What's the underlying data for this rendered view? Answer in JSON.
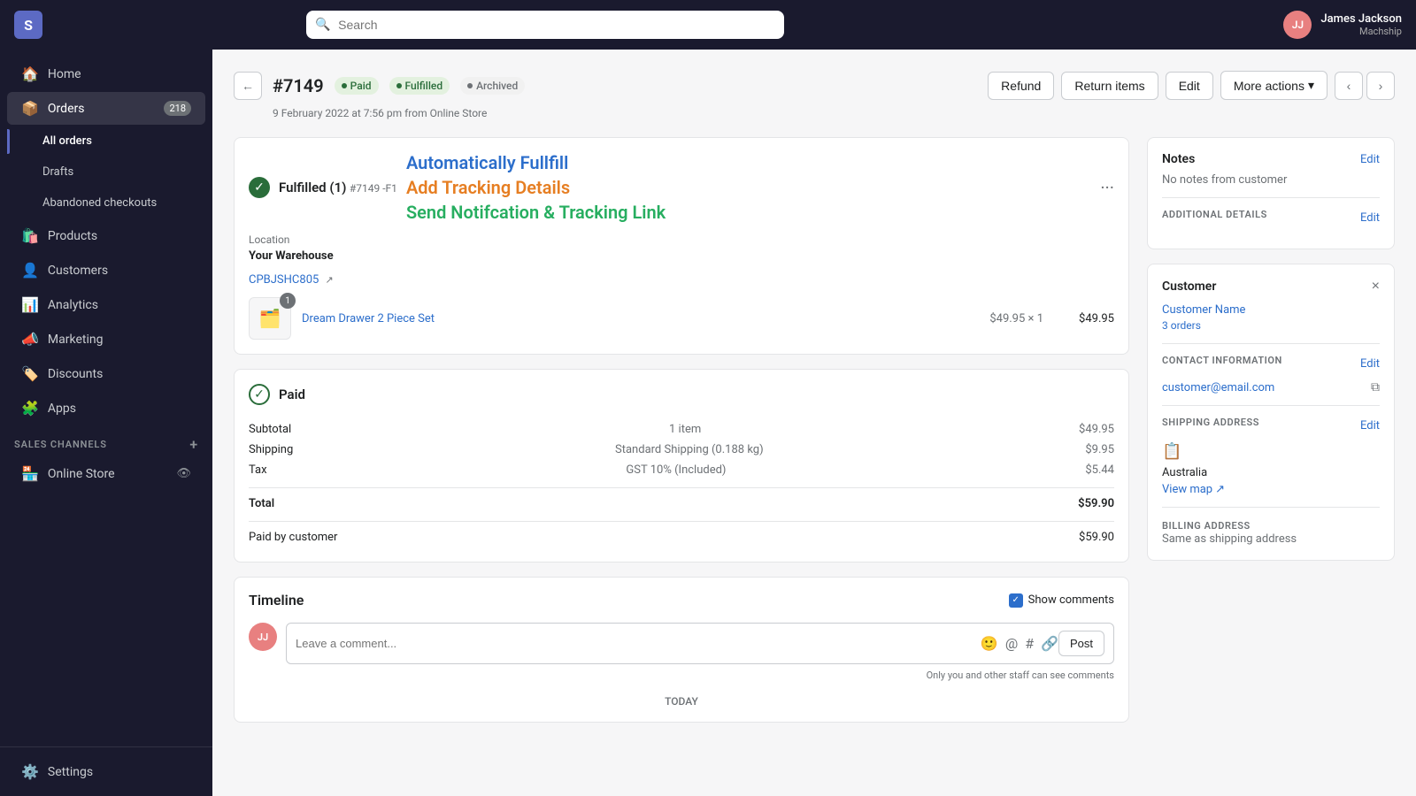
{
  "topnav": {
    "logo_text": "S",
    "search_placeholder": "Search",
    "user_initials": "JJ",
    "user_name": "James Jackson",
    "user_shop": "Machship"
  },
  "sidebar": {
    "items": [
      {
        "id": "home",
        "label": "Home",
        "icon": "🏠",
        "badge": null
      },
      {
        "id": "orders",
        "label": "Orders",
        "icon": "📦",
        "badge": "218"
      },
      {
        "id": "all-orders",
        "label": "All orders",
        "icon": null,
        "badge": null,
        "sub": true,
        "active": true
      },
      {
        "id": "drafts",
        "label": "Drafts",
        "icon": null,
        "badge": null,
        "sub": true
      },
      {
        "id": "abandoned",
        "label": "Abandoned checkouts",
        "icon": null,
        "badge": null,
        "sub": true
      },
      {
        "id": "products",
        "label": "Products",
        "icon": "🛍️",
        "badge": null
      },
      {
        "id": "customers",
        "label": "Customers",
        "icon": "👤",
        "badge": null
      },
      {
        "id": "analytics",
        "label": "Analytics",
        "icon": "📊",
        "badge": null
      },
      {
        "id": "marketing",
        "label": "Marketing",
        "icon": "📣",
        "badge": null
      },
      {
        "id": "discounts",
        "label": "Discounts",
        "icon": "🏷️",
        "badge": null
      },
      {
        "id": "apps",
        "label": "Apps",
        "icon": "🧩",
        "badge": null
      }
    ],
    "sales_channels_label": "SALES CHANNELS",
    "channels": [
      {
        "id": "online-store",
        "label": "Online Store"
      }
    ],
    "settings_label": "Settings"
  },
  "order": {
    "back_label": "←",
    "number": "#7149",
    "badges": [
      {
        "type": "paid",
        "label": "Paid"
      },
      {
        "type": "fulfilled",
        "label": "Fulfilled"
      },
      {
        "type": "archived",
        "label": "Archived"
      }
    ],
    "actions": {
      "refund": "Refund",
      "return": "Return items",
      "edit": "Edit",
      "more": "More actions"
    },
    "meta": "9 February 2022 at 7:56 pm from Online Store",
    "fulfilled_section": {
      "icon": "✓",
      "title": "Fulfilled (1)",
      "subtitle": "#7149 -F1",
      "location_label": "Location",
      "location": "Your Warehouse",
      "tracking_code": "CPBJSHC805",
      "auto_fill_line1": "Automatically Fullfill",
      "auto_fill_line2": "Add Tracking Details",
      "auto_fill_line3": "Send Notifcation & Tracking Link",
      "product_img": "🖼️",
      "product_qty": "1",
      "product_name": "Dream Drawer 2 Piece Set",
      "product_unit_price": "$49.95",
      "product_qty_label": "× 1",
      "product_total": "$49.95"
    },
    "payment_section": {
      "icon": "✓",
      "title": "Paid",
      "subtotal_label": "Subtotal",
      "subtotal_qty": "1 item",
      "subtotal_amount": "$49.95",
      "shipping_label": "Shipping",
      "shipping_desc": "Standard Shipping (0.188 kg)",
      "shipping_amount": "$9.95",
      "tax_label": "Tax",
      "tax_desc": "GST 10% (Included)",
      "tax_amount": "$5.44",
      "total_label": "Total",
      "total_amount": "$59.90",
      "paid_by_label": "Paid by customer",
      "paid_by_amount": "$59.90"
    },
    "timeline": {
      "title": "Timeline",
      "show_comments_label": "Show comments",
      "comment_avatar": "JJ",
      "comment_placeholder": "Leave a comment...",
      "post_label": "Post",
      "staff_note": "Only you and other staff can see comments",
      "date_label": "TODAY"
    }
  },
  "right_sidebar": {
    "notes": {
      "title": "Notes",
      "edit_label": "Edit",
      "empty_text": "No notes from customer",
      "additional_details_label": "ADDITIONAL DETAILS",
      "additional_edit_label": "Edit"
    },
    "customer": {
      "title": "Customer",
      "close_icon": "×",
      "name": "Customer Name",
      "orders_link": "3 orders",
      "contact_label": "CONTACT INFORMATION",
      "contact_edit": "Edit",
      "email": "customer@email.com",
      "shipping_label": "SHIPPING ADDRESS",
      "shipping_edit": "Edit",
      "country": "Australia",
      "view_map_label": "View map",
      "billing_label": "BILLING ADDRESS",
      "billing_same": "Same as shipping address"
    }
  }
}
